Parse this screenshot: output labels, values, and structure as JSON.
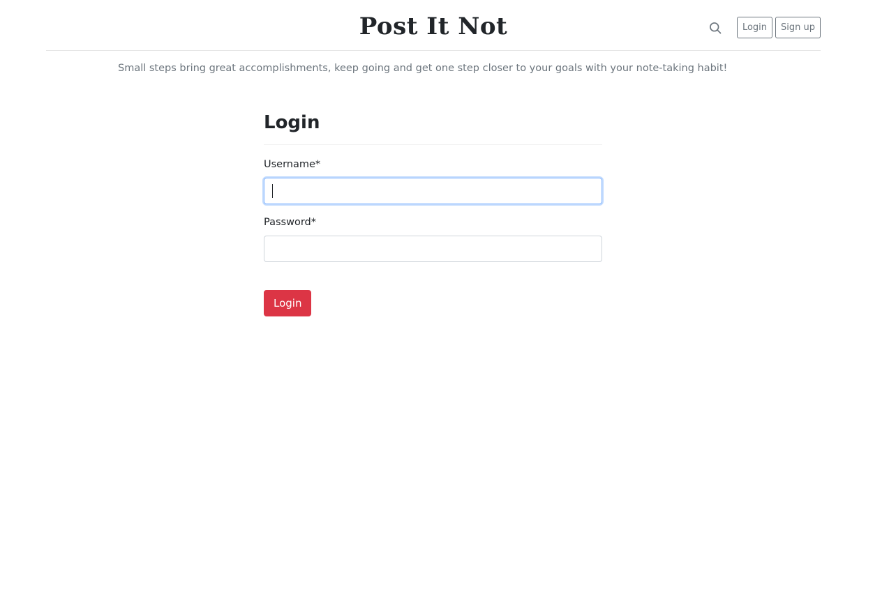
{
  "header": {
    "site_title": "Post It Not",
    "search_icon": "search-icon",
    "login_label": "Login",
    "signup_label": "Sign up"
  },
  "tagline": "Small steps bring great accomplishments, keep going and get one step closer to your goals with your note-taking habit!",
  "login_form": {
    "heading": "Login",
    "username_label": "Username*",
    "username_value": "",
    "password_label": "Password*",
    "password_value": "",
    "submit_label": "Login"
  },
  "colors": {
    "accent_red": "#dc3545",
    "muted_text": "#6c757d",
    "focus_ring": "#86b7fe"
  }
}
